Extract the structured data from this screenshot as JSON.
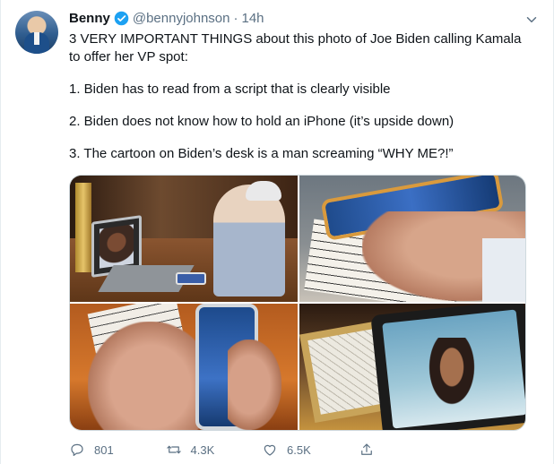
{
  "tweet": {
    "author_name": "Benny",
    "author_handle": "@bennyjohnson",
    "separator": "·",
    "timestamp": "14h",
    "verified": true,
    "paragraphs": [
      "3 VERY IMPORTANT THINGS about this photo of Joe Biden calling Kamala to offer her VP spot:",
      "1. Biden has to read from a script that is clearly visible",
      "2. Biden does not know how to hold an iPhone (it’s upside down)",
      "3. The cartoon on Biden’s desk is a man screaming “WHY ME?!”"
    ]
  },
  "actions": {
    "reply_count": "801",
    "retweet_count": "4.3K",
    "like_count": "6.5K"
  },
  "icons": {
    "verified": "verified-badge-icon",
    "caret": "chevron-down-icon",
    "reply": "reply-icon",
    "retweet": "retweet-icon",
    "like": "heart-icon",
    "share": "share-icon"
  },
  "colors": {
    "accent": "#1da1f2",
    "muted": "#5b7083",
    "text": "#0f1419",
    "border": "#cfd9de"
  }
}
